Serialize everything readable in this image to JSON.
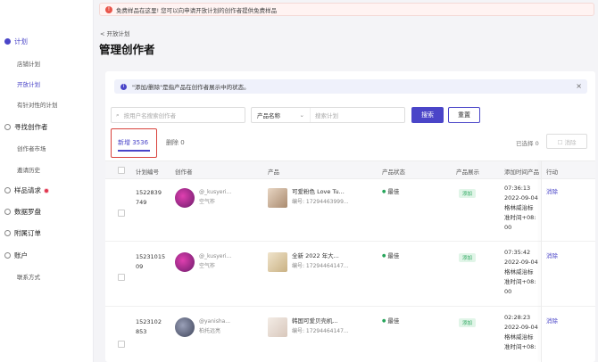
{
  "banner": {
    "text": "免费样品在这里! 您可以向申请开放计划的创作者提供免费样品"
  },
  "sidebar": {
    "groups": [
      {
        "label": "计划",
        "subs": [
          "店铺计划",
          "开放计划",
          "有针对性的计划"
        ]
      },
      {
        "label": "寻找创作者",
        "subs": [
          "创作者市场",
          "邀请历史"
        ]
      },
      {
        "label": "样品请求"
      },
      {
        "label": "数据罗盘"
      },
      {
        "label": "附属订单"
      },
      {
        "label": "账户",
        "subs": [
          "联系方式"
        ]
      }
    ]
  },
  "breadcrumb": "< 开放计划",
  "page_title": "管理创作者",
  "info": {
    "text": "\"添加/删除\"是指产品在创作者展示中的状态。"
  },
  "search": {
    "creator_placeholder": "按用户名搜索创作者",
    "product_select": "产品名称",
    "plan_placeholder": "搜索计划",
    "search_label": "搜索",
    "reset_label": "重置"
  },
  "tabs": {
    "added": "新增 3536",
    "removed": "删除 0"
  },
  "toolbar": {
    "selected": "已选择 0",
    "remove_label": "☐ 消除"
  },
  "table": {
    "headers": [
      "计划编号",
      "创作者",
      "产品",
      "产品状态",
      "产品展示",
      "添加时间产品",
      "行动"
    ],
    "rows": [
      {
        "plan_line1": "1522839",
        "plan_line2": "749",
        "creator_handle": "@_kusyeri...",
        "creator_name": "空气祚",
        "product_name": "可爱粉色 Love Tu...",
        "product_id": "编号: 17294463999...",
        "status": "最佳",
        "display": "添加",
        "time_1": "07:36:13",
        "time_2": "2022-09-04",
        "time_3": "格林威治标",
        "time_4": "准时间+08:",
        "time_5": "00",
        "action": "消除"
      },
      {
        "plan_line1": "15231015",
        "plan_line2": "09",
        "creator_handle": "@_kusyeri...",
        "creator_name": "空气祚",
        "product_name": "全新 2022 年大...",
        "product_id": "编号: 17294464147...",
        "status": "最佳",
        "display": "添加",
        "time_1": "07:35:42",
        "time_2": "2022-09-04",
        "time_3": "格林威治标",
        "time_4": "准时间+08:",
        "time_5": "00",
        "action": "消除"
      },
      {
        "plan_line1": "1523102",
        "plan_line2": "853",
        "creator_handle": "@yanisha...",
        "creator_name": "柏托远亮",
        "product_name": "韩国可爱贝壳机...",
        "product_id": "编号: 17294464147...",
        "status": "最佳",
        "display": "添加",
        "time_1": "02:28:23",
        "time_2": "2022-09-04",
        "time_3": "格林威治标",
        "time_4": "准时间+08:",
        "time_5": "00",
        "action": "消除"
      }
    ]
  },
  "colors": {
    "accent": "#4a45c8",
    "status_green": "#27a55b",
    "highlight_red": "#d9423c"
  }
}
